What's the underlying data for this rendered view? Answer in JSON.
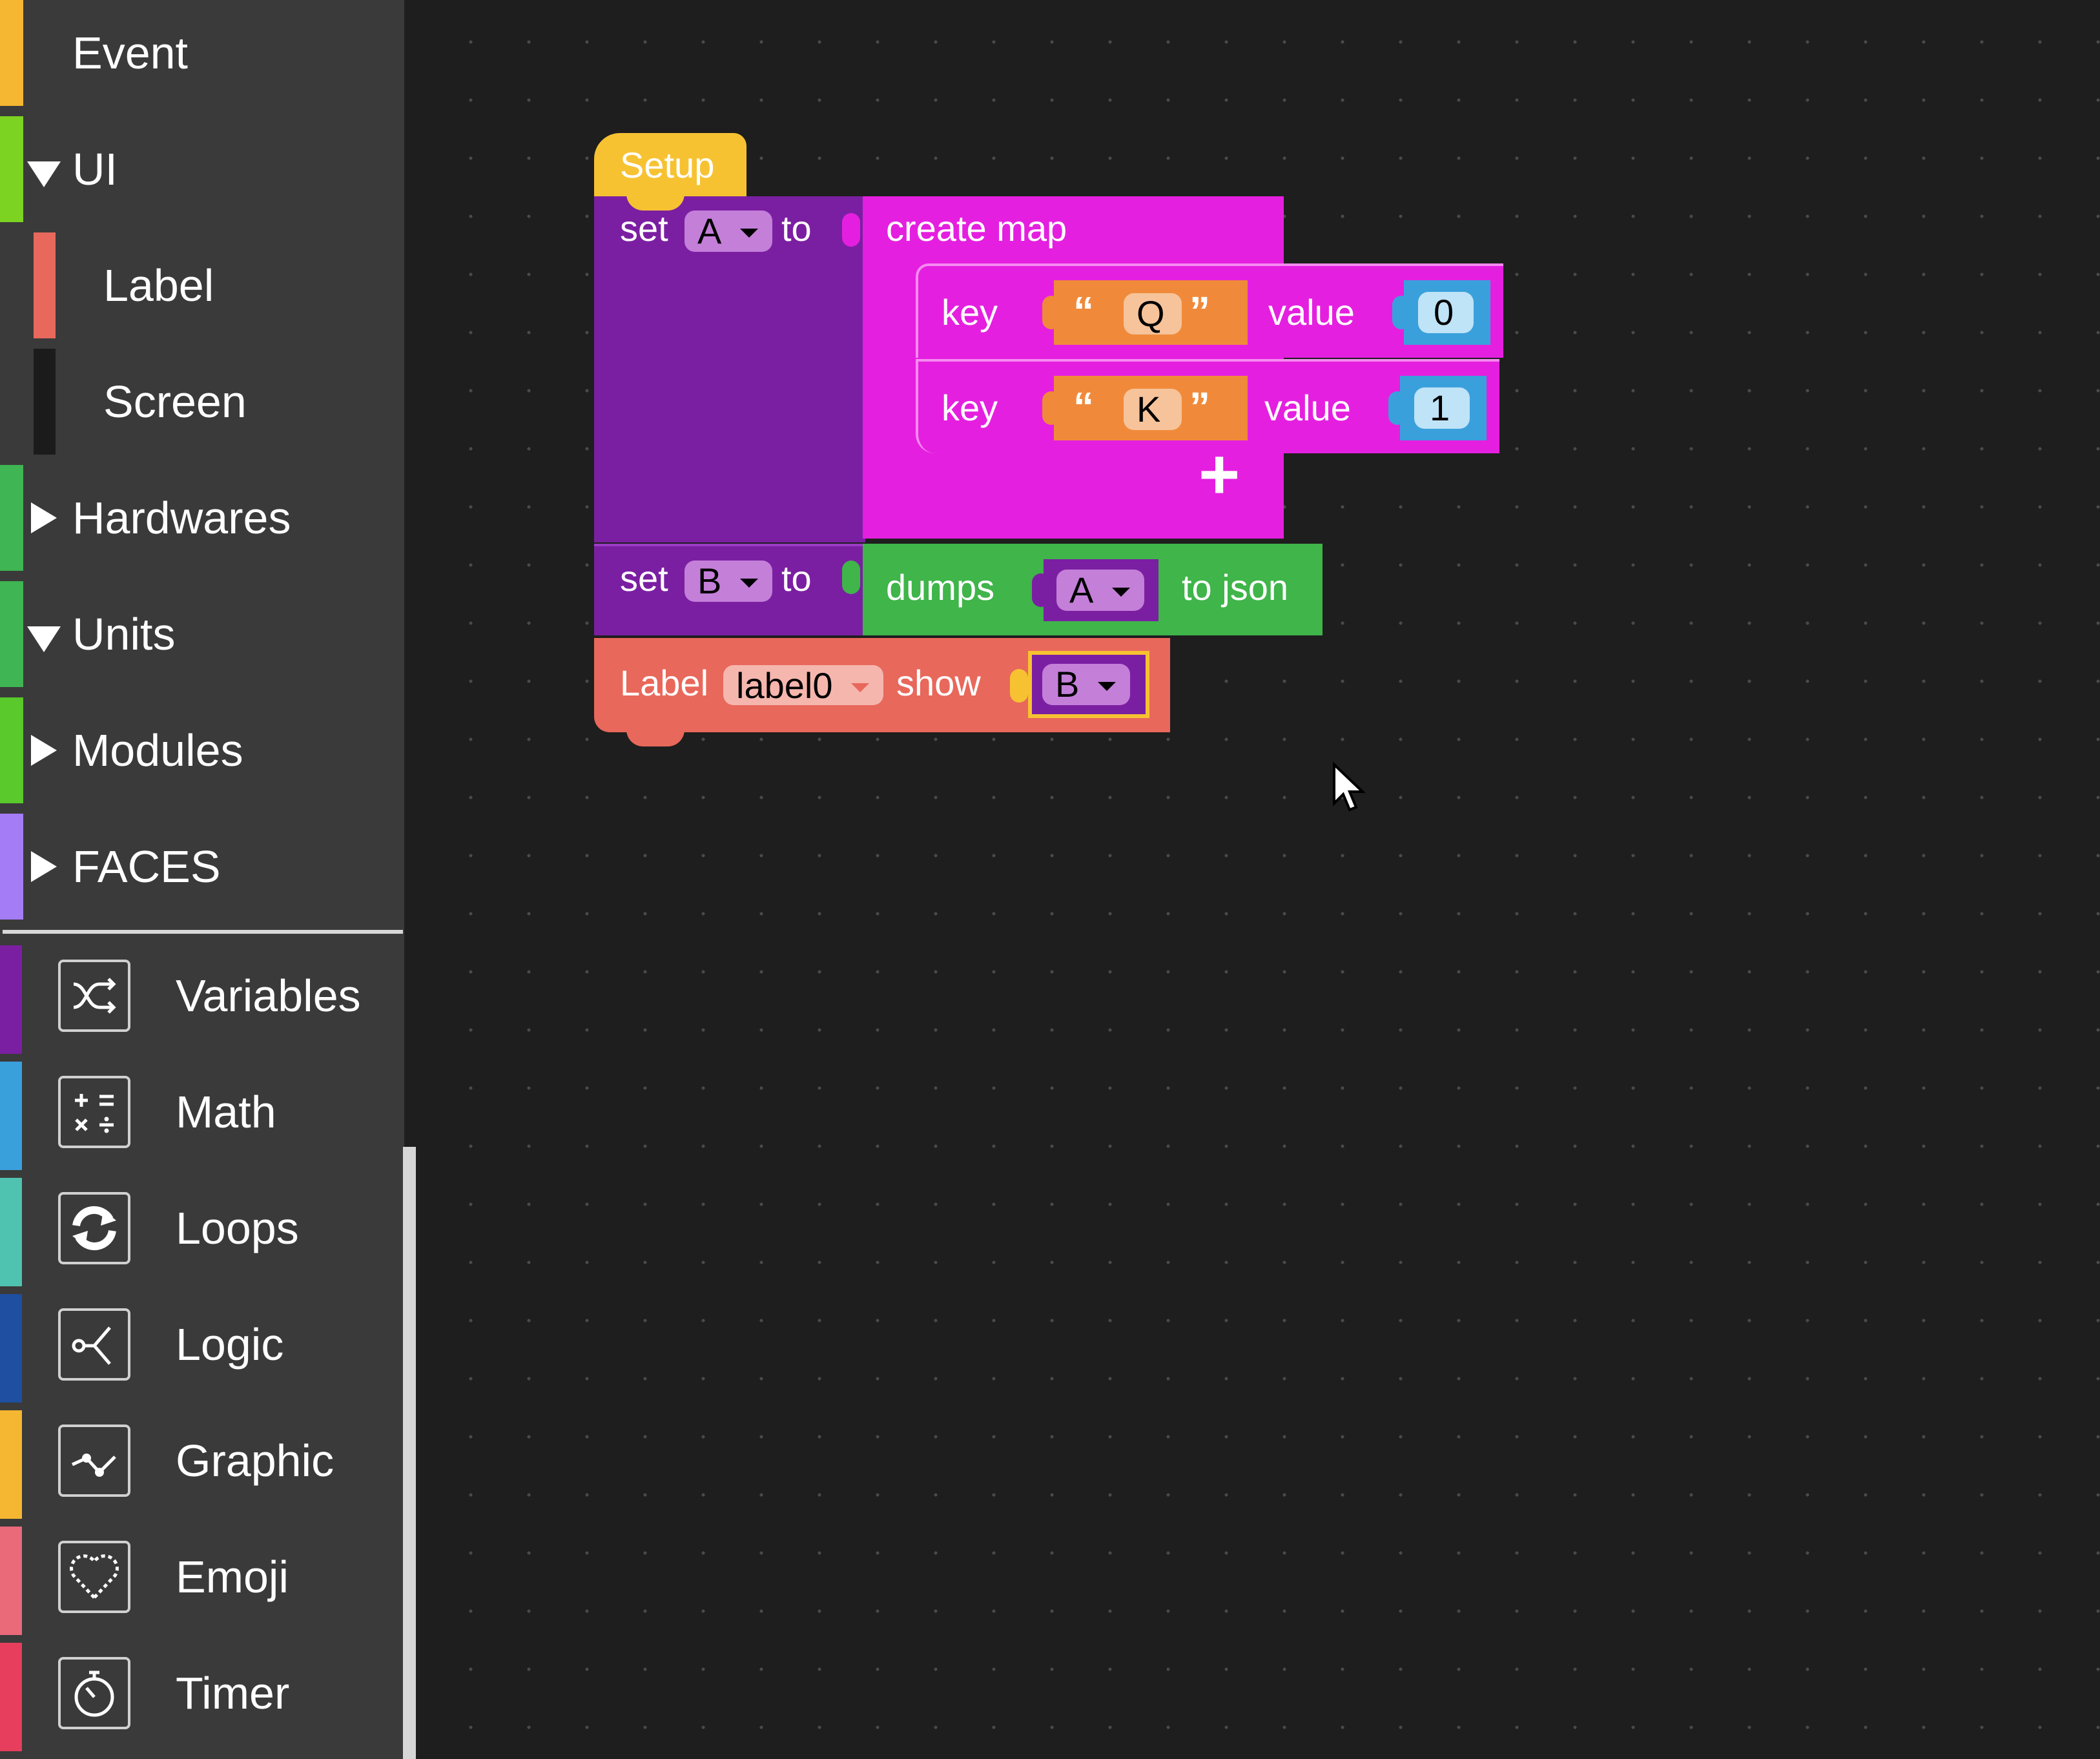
{
  "sidebar": {
    "categories": [
      {
        "label": "Event",
        "color": "#f5b731",
        "state": "none"
      },
      {
        "label": "UI",
        "color": "#7dd321",
        "state": "expanded"
      },
      {
        "label": "Label",
        "color": "#e8685b",
        "state": "child"
      },
      {
        "label": "Screen",
        "color": "#1b1b1b",
        "state": "child"
      },
      {
        "label": "Hardwares",
        "color": "#3fb553",
        "state": "collapsed"
      },
      {
        "label": "Units",
        "color": "#3fb553",
        "state": "expanded"
      },
      {
        "label": "Modules",
        "color": "#59c92c",
        "state": "collapsed"
      },
      {
        "label": "FACES",
        "color": "#a47cf6",
        "state": "collapsed"
      }
    ],
    "tools": [
      {
        "label": "Variables",
        "color": "#7b1fa2",
        "icon": "variables-icon"
      },
      {
        "label": "Math",
        "color": "#3aa0dc",
        "icon": "math-icon"
      },
      {
        "label": "Loops",
        "color": "#4fc2b0",
        "icon": "loops-icon"
      },
      {
        "label": "Logic",
        "color": "#1e4fa0",
        "icon": "logic-icon"
      },
      {
        "label": "Graphic",
        "color": "#f5b731",
        "icon": "graphic-icon"
      },
      {
        "label": "Emoji",
        "color": "#ea6a7a",
        "icon": "emoji-icon"
      },
      {
        "label": "Timer",
        "color": "#e63e5c",
        "icon": "timer-icon"
      }
    ]
  },
  "blocks": {
    "setup": {
      "label": "Setup",
      "color": "#f7c232"
    },
    "set_a": {
      "set": "set",
      "var": "A",
      "to": "to",
      "color": "#7b1fa2"
    },
    "create_map": {
      "label": "create map",
      "color": "#e51fe0",
      "rows": [
        {
          "key_label": "key",
          "open_quote": "“",
          "key": "Q",
          "close_quote": "”",
          "value_label": "value",
          "value": "0"
        },
        {
          "key_label": "key",
          "open_quote": "“",
          "key": "K",
          "close_quote": "”",
          "value_label": "value",
          "value": "1"
        }
      ],
      "add": "+"
    },
    "set_b": {
      "set": "set",
      "var": "B",
      "to": "to",
      "color": "#7b1fa2"
    },
    "dumps": {
      "label": "dumps",
      "var": "A",
      "suffix": "to json",
      "color": "#3fb54a"
    },
    "label_show": {
      "label": "Label",
      "field": "label0",
      "show": "show",
      "var": "B",
      "color": "#e8685b"
    },
    "colors": {
      "text_block": "#f08a3a",
      "number_block": "#3aa0dc",
      "highlight": "#f7c232"
    }
  }
}
